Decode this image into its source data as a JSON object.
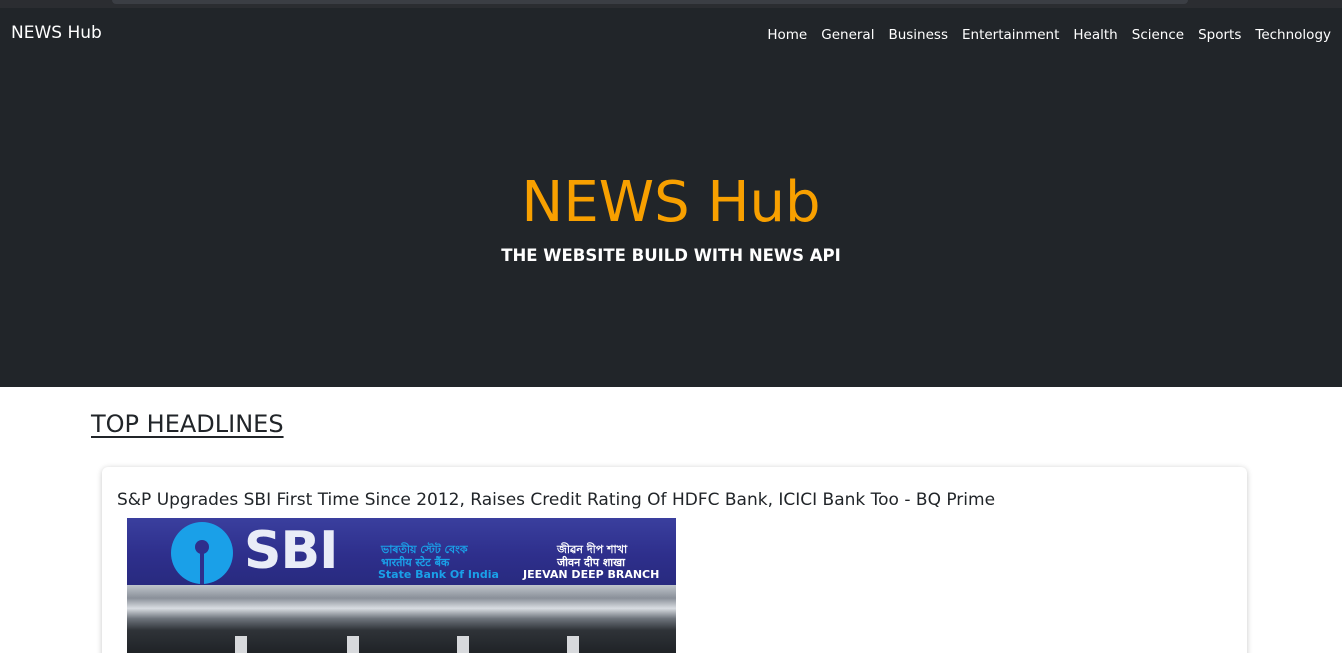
{
  "navbar": {
    "brand": "NEWS Hub",
    "links": [
      "Home",
      "General",
      "Business",
      "Entertainment",
      "Health",
      "Science",
      "Sports",
      "Technology"
    ]
  },
  "hero": {
    "title": "NEWS Hub",
    "subtitle": "THE WEBSITE BUILD WITH NEWS API"
  },
  "section": {
    "title": "TOP HEADLINES"
  },
  "articles": [
    {
      "title": "S&P Upgrades SBI First Time Since 2012, Raises Credit Rating Of HDFC Bank, ICICI Bank Too - BQ Prime",
      "image": {
        "logo_text": "SBI",
        "sign_hindi_1": "ভাৰতীয় স্টেট বেংক",
        "sign_hindi_2": "भारतीय स्टेट बैंक",
        "sign_english": "State Bank Of India",
        "branch_local_1": "জীৱন দীপ শাখা",
        "branch_local_2": "जीवन दीप शाखा",
        "branch_english": "JEEVAN DEEP BRANCH"
      }
    }
  ],
  "colors": {
    "header_bg": "#212529",
    "hero_title": "#f8a000",
    "text_light": "#ffffff",
    "text_dark": "#212529"
  }
}
